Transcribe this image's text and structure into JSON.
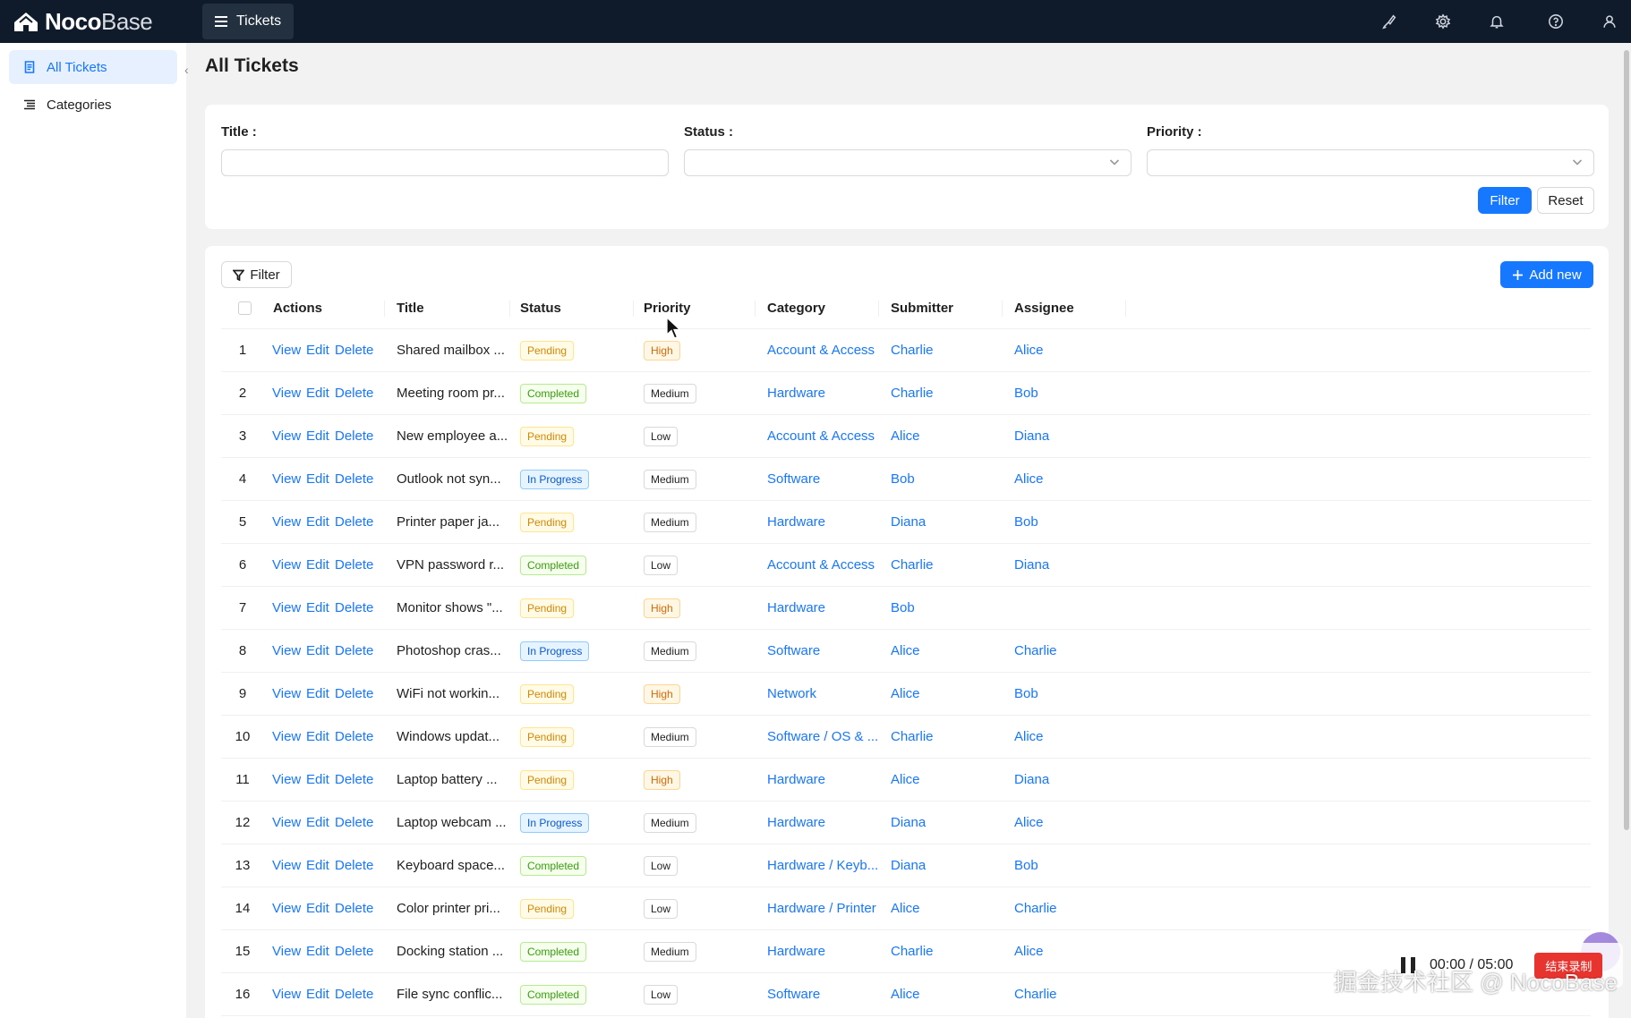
{
  "app": {
    "logo_bold": "Noco",
    "logo_light": "Base",
    "menu_tab": "Tickets",
    "top_icons": [
      "brush-icon",
      "gear-icon",
      "bell-icon",
      "help-icon",
      "user-icon"
    ]
  },
  "sidebar": {
    "items": [
      {
        "label": "All Tickets",
        "icon": "document-icon",
        "active": true
      },
      {
        "label": "Categories",
        "icon": "list-icon",
        "active": false
      }
    ]
  },
  "page": {
    "title": "All Tickets"
  },
  "filter_form": {
    "title_label": "Title :",
    "status_label": "Status :",
    "priority_label": "Priority :",
    "filter_button": "Filter",
    "reset_button": "Reset"
  },
  "table": {
    "filter_button": "Filter",
    "add_new_button": "Add new",
    "columns": [
      "Actions",
      "Title",
      "Status",
      "Priority",
      "Category",
      "Submitter",
      "Assignee"
    ],
    "actions": {
      "view": "View",
      "edit": "Edit",
      "delete": "Delete"
    },
    "rows": [
      {
        "no": "1",
        "title": "Shared mailbox ...",
        "status": "Pending",
        "priority": "High",
        "category": "Account & Access",
        "submitter": "Charlie",
        "assignee": "Alice"
      },
      {
        "no": "2",
        "title": "Meeting room pr...",
        "status": "Completed",
        "priority": "Medium",
        "category": "Hardware",
        "submitter": "Charlie",
        "assignee": "Bob"
      },
      {
        "no": "3",
        "title": "New employee a...",
        "status": "Pending",
        "priority": "Low",
        "category": "Account & Access",
        "submitter": "Alice",
        "assignee": "Diana"
      },
      {
        "no": "4",
        "title": "Outlook not syn...",
        "status": "In Progress",
        "priority": "Medium",
        "category": "Software",
        "submitter": "Bob",
        "assignee": "Alice"
      },
      {
        "no": "5",
        "title": "Printer paper ja...",
        "status": "Pending",
        "priority": "Medium",
        "category": "Hardware",
        "submitter": "Diana",
        "assignee": "Bob"
      },
      {
        "no": "6",
        "title": "VPN password r...",
        "status": "Completed",
        "priority": "Low",
        "category": "Account & Access",
        "submitter": "Charlie",
        "assignee": "Diana"
      },
      {
        "no": "7",
        "title": "Monitor shows \"...",
        "status": "Pending",
        "priority": "High",
        "category": "Hardware",
        "submitter": "Bob",
        "assignee": ""
      },
      {
        "no": "8",
        "title": "Photoshop cras...",
        "status": "In Progress",
        "priority": "Medium",
        "category": "Software",
        "submitter": "Alice",
        "assignee": "Charlie"
      },
      {
        "no": "9",
        "title": "WiFi not workin...",
        "status": "Pending",
        "priority": "High",
        "category": "Network",
        "submitter": "Alice",
        "assignee": "Bob"
      },
      {
        "no": "10",
        "title": "Windows updat...",
        "status": "Pending",
        "priority": "Medium",
        "category": "Software / OS & ...",
        "submitter": "Charlie",
        "assignee": "Alice"
      },
      {
        "no": "11",
        "title": "Laptop battery ...",
        "status": "Pending",
        "priority": "High",
        "category": "Hardware",
        "submitter": "Alice",
        "assignee": "Diana"
      },
      {
        "no": "12",
        "title": "Laptop webcam ...",
        "status": "In Progress",
        "priority": "Medium",
        "category": "Hardware",
        "submitter": "Diana",
        "assignee": "Alice"
      },
      {
        "no": "13",
        "title": "Keyboard space...",
        "status": "Completed",
        "priority": "Low",
        "category": "Hardware / Keyb...",
        "submitter": "Diana",
        "assignee": "Bob"
      },
      {
        "no": "14",
        "title": "Color printer pri...",
        "status": "Pending",
        "priority": "Low",
        "category": "Hardware / Printer",
        "submitter": "Alice",
        "assignee": "Charlie"
      },
      {
        "no": "15",
        "title": "Docking station ...",
        "status": "Completed",
        "priority": "Medium",
        "category": "Hardware",
        "submitter": "Charlie",
        "assignee": "Alice"
      },
      {
        "no": "16",
        "title": "File sync conflic...",
        "status": "Completed",
        "priority": "Low",
        "category": "Software",
        "submitter": "Alice",
        "assignee": "Charlie"
      }
    ]
  },
  "recorder": {
    "time": "00:00 / 05:00",
    "stop_label": "结束录制"
  },
  "watermark": "掘金技术社区 @ NocoBase",
  "colors": {
    "topbar": "#0f1a2a",
    "accent": "#1677ff",
    "page_bg": "#f2f2f3"
  }
}
